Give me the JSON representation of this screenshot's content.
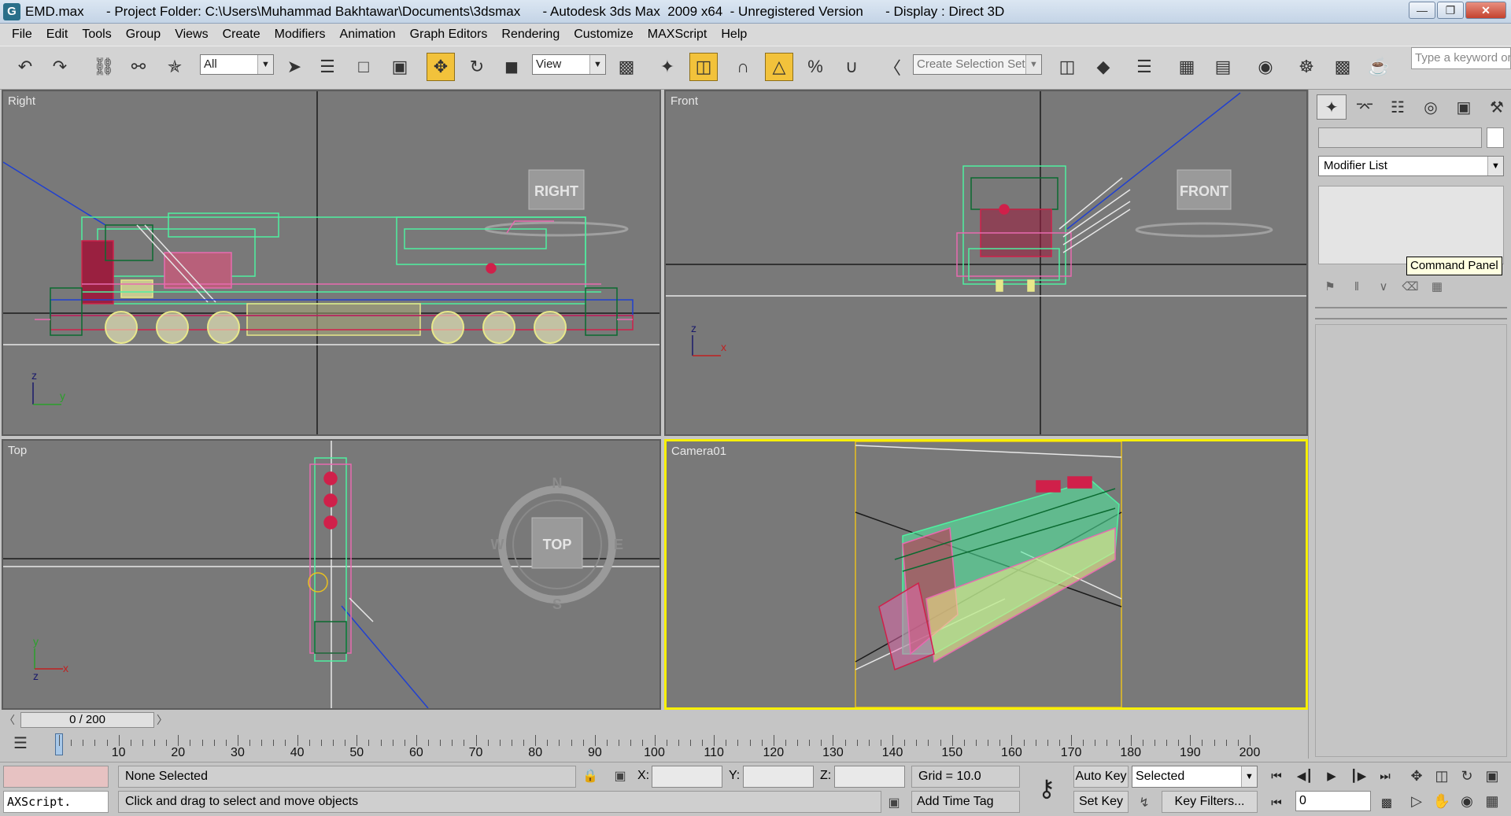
{
  "window": {
    "title": "EMD.max      - Project Folder: C:\\Users\\Muhammad Bakhtawar\\Documents\\3dsmax      - Autodesk 3ds Max  2009 x64  - Unregistered Version      - Display : Direct 3D",
    "app_icon": "G"
  },
  "menu": [
    "File",
    "Edit",
    "Tools",
    "Group",
    "Views",
    "Create",
    "Modifiers",
    "Animation",
    "Graph Editors",
    "Rendering",
    "Customize",
    "MAXScript",
    "Help"
  ],
  "toolbar": {
    "selection_filter": "All",
    "reference_coord": "View",
    "named_selection": "Create Selection Set",
    "search_placeholder": "Type a keyword or"
  },
  "viewports": {
    "right": {
      "label": "Right",
      "cube": "RIGHT"
    },
    "front": {
      "label": "Front",
      "cube": "FRONT"
    },
    "top": {
      "label": "Top",
      "cube": "TOP",
      "compass": [
        "N",
        "E",
        "S",
        "W"
      ]
    },
    "camera": {
      "label": "Camera01"
    }
  },
  "axes": {
    "z": "z",
    "y": "y",
    "x": "x"
  },
  "command_panel": {
    "modifier_list": "Modifier List",
    "tooltip": "Command Panel"
  },
  "timeline": {
    "frame_display": "0 / 200",
    "ticks": [
      "10",
      "20",
      "30",
      "40",
      "50",
      "60",
      "70",
      "80",
      "90",
      "100",
      "110",
      "120",
      "130",
      "140",
      "150",
      "160",
      "170",
      "180",
      "190",
      "200"
    ]
  },
  "status": {
    "maxscript": "AXScript.",
    "selection": "None Selected",
    "prompt": "Click and drag to select and move objects",
    "x_label": "X:",
    "y_label": "Y:",
    "z_label": "Z:",
    "grid": "Grid = 10.0",
    "add_time_tag": "Add Time Tag",
    "auto_key": "Auto Key",
    "set_key": "Set Key",
    "selected_dropdown": "Selected",
    "key_filters": "Key Filters...",
    "current_frame": "0"
  },
  "colors": {
    "active_viewport": "#f7f000",
    "viewport_bg": "#797979",
    "wire_green": "#4ff0a0",
    "wire_red": "#d0204a",
    "wire_pink": "#e86ab0",
    "wire_yellow": "#e8e88a",
    "wire_blue": "#2040d0"
  }
}
